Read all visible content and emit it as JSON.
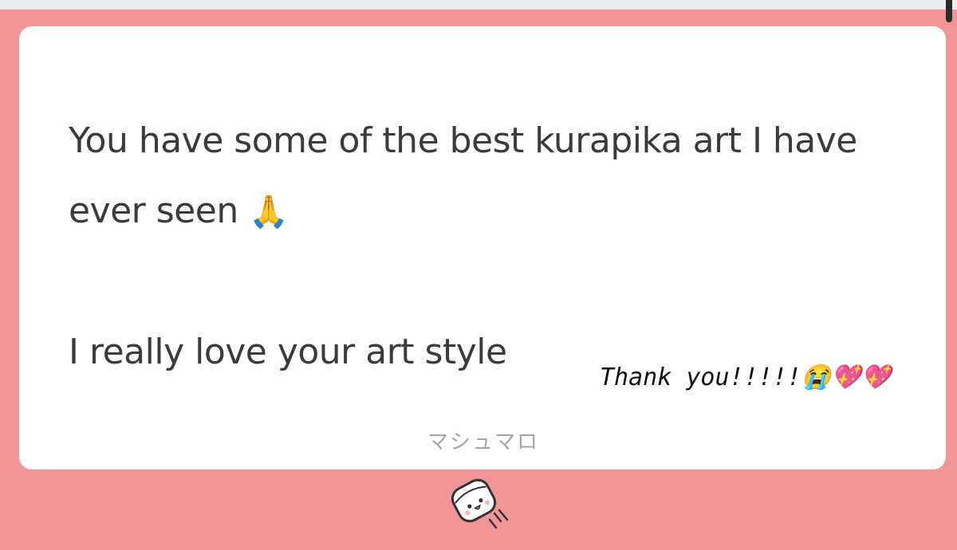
{
  "card": {
    "message_line1": "You have some of the best kurapika art I have ever seen",
    "message_emoji": "🙏",
    "message_line2": "I really love your art style",
    "reply_note": "Thank you!!!!!😭💖💖",
    "brand_label": "マシュマロ"
  },
  "icons": {
    "prayer": "folded-hands-icon",
    "logo": "marshmallow-logo-icon"
  },
  "colors": {
    "background": "#f29597",
    "card": "#ffffff",
    "text": "#3d3a3b",
    "brand_text": "#a6a6a6"
  }
}
